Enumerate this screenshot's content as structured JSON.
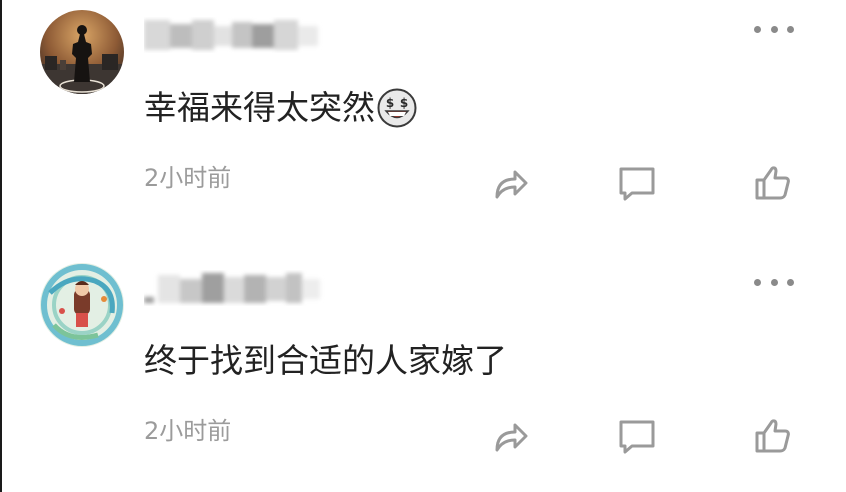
{
  "comments": [
    {
      "avatar": "dark-figure-portrait",
      "username_blurred": true,
      "text": "幸福来得太突然",
      "emoji": "money-mouth-face",
      "time": "2小时前",
      "actions": {
        "share_icon": "share-icon",
        "reply_icon": "comment-icon",
        "like_icon": "thumbs-up-icon"
      },
      "more_icon": "more-icon"
    },
    {
      "avatar": "anime-dragon-portrait",
      "username_blurred": true,
      "text": "终于找到合适的人家嫁了",
      "time": "2小时前",
      "actions": {
        "share_icon": "share-icon",
        "reply_icon": "comment-icon",
        "like_icon": "thumbs-up-icon"
      },
      "more_icon": "more-icon"
    }
  ],
  "colors": {
    "text": "#222222",
    "meta": "#9b9b9b",
    "icon": "#9a9a9a",
    "background": "#ffffff"
  }
}
